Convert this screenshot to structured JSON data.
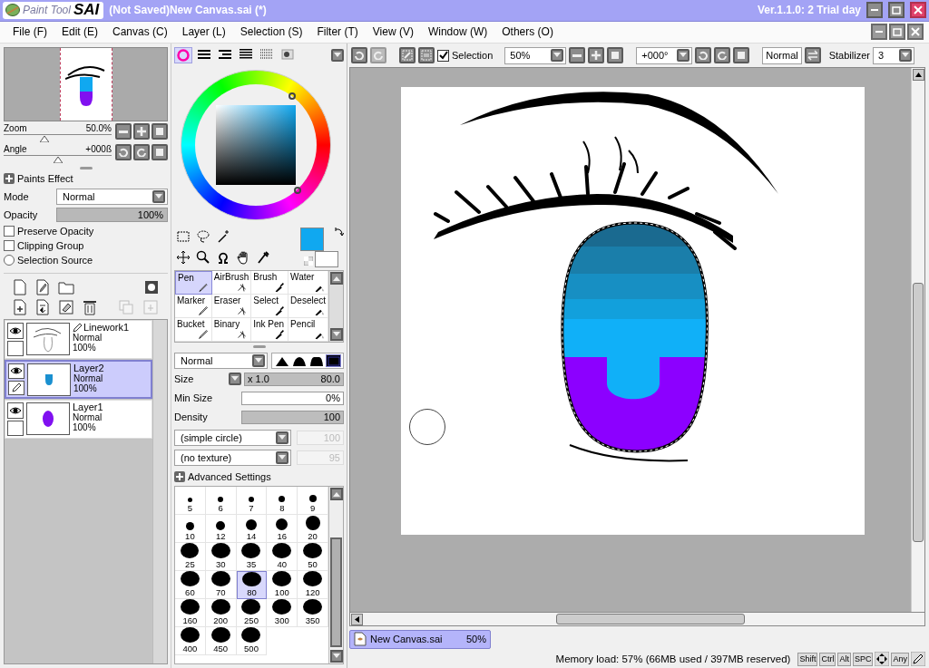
{
  "title_bar": {
    "logo_text": "Paint Tool",
    "logo_mark": "SAI",
    "document_title": "(Not Saved)New Canvas.sai (*)",
    "version": "Ver.1.1.0: 2 Trial day"
  },
  "menu": [
    "File (F)",
    "Edit (E)",
    "Canvas (C)",
    "Layer (L)",
    "Selection (S)",
    "Filter (T)",
    "View (V)",
    "Window (W)",
    "Others (O)"
  ],
  "navigator": {
    "zoom": {
      "label": "Zoom",
      "value": "50.0%",
      "level": 0.38
    },
    "angle": {
      "label": "Angle",
      "value": "+000ß",
      "level": 0.5
    }
  },
  "paints_effect": {
    "title": "Paints Effect",
    "mode": {
      "label": "Mode",
      "value": "Normal"
    },
    "opacity": {
      "label": "Opacity",
      "value": "100%",
      "level": 1
    },
    "options": [
      {
        "kind": "checkbox",
        "label": "Preserve Opacity",
        "checked": false
      },
      {
        "kind": "checkbox",
        "label": "Clipping Group",
        "checked": false
      },
      {
        "kind": "radio",
        "label": "Selection Source",
        "checked": false
      }
    ]
  },
  "layers": [
    {
      "name": "Linework1",
      "kind": "linework",
      "blend": "Normal",
      "opacity": "100%",
      "visible": true,
      "selected": false
    },
    {
      "name": "Layer2",
      "kind": "normal",
      "blend": "Normal",
      "opacity": "100%",
      "visible": true,
      "selected": true
    },
    {
      "name": "Layer1",
      "kind": "normal",
      "blend": "Normal",
      "opacity": "100%",
      "visible": true,
      "selected": false
    }
  ],
  "color_modes": [
    {
      "selected": true
    },
    {
      "selected": false
    },
    {
      "selected": false
    },
    {
      "selected": false
    },
    {
      "selected": false
    },
    {
      "selected": false
    }
  ],
  "tools": [
    {
      "label": "Pen",
      "selected": true
    },
    {
      "label": "AirBrush",
      "selected": false
    },
    {
      "label": "Brush",
      "selected": false
    },
    {
      "label": "Water",
      "selected": false
    },
    {
      "label": "Marker",
      "selected": false
    },
    {
      "label": "Eraser",
      "selected": false
    },
    {
      "label": "Select",
      "selected": false
    },
    {
      "label": "Deselect",
      "selected": false
    },
    {
      "label": "Bucket",
      "selected": false
    },
    {
      "label": "Binary",
      "selected": false
    },
    {
      "label": "Ink Pen",
      "selected": false
    },
    {
      "label": "Pencil",
      "selected": false
    }
  ],
  "brush": {
    "blend": "Normal",
    "shapes": [
      {
        "selected": false
      },
      {
        "selected": false
      },
      {
        "selected": false
      },
      {
        "selected": true
      }
    ],
    "size": {
      "label": "Size",
      "multiplier": "x 1.0",
      "value": "80.0",
      "level": 1
    },
    "min_size": {
      "label": "Min Size",
      "value": "0%",
      "level": 0
    },
    "density": {
      "label": "Density",
      "value": "100",
      "level": 1
    },
    "shape": {
      "value": "(simple circle)",
      "strength": "100"
    },
    "texture": {
      "value": "(no texture)",
      "strength": "95"
    },
    "advanced": "Advanced Settings"
  },
  "brush_sizes": [
    {
      "label": "5",
      "selected": false
    },
    {
      "label": "6",
      "selected": false
    },
    {
      "label": "7",
      "selected": false
    },
    {
      "label": "8",
      "selected": false
    },
    {
      "label": "9",
      "selected": false
    },
    {
      "label": "10",
      "selected": false
    },
    {
      "label": "12",
      "selected": false
    },
    {
      "label": "14",
      "selected": false
    },
    {
      "label": "16",
      "selected": false
    },
    {
      "label": "20",
      "selected": false
    },
    {
      "label": "25",
      "selected": false
    },
    {
      "label": "30",
      "selected": false
    },
    {
      "label": "35",
      "selected": false
    },
    {
      "label": "40",
      "selected": false
    },
    {
      "label": "50",
      "selected": false
    },
    {
      "label": "60",
      "selected": false
    },
    {
      "label": "70",
      "selected": false
    },
    {
      "label": "80",
      "selected": true
    },
    {
      "label": "100",
      "selected": false
    },
    {
      "label": "120",
      "selected": false
    },
    {
      "label": "160",
      "selected": false
    },
    {
      "label": "200",
      "selected": false
    },
    {
      "label": "250",
      "selected": false
    },
    {
      "label": "300",
      "selected": false
    },
    {
      "label": "350",
      "selected": false
    },
    {
      "label": "400",
      "selected": false
    },
    {
      "label": "450",
      "selected": false
    },
    {
      "label": "500",
      "selected": false
    }
  ],
  "canvas_toolbar": {
    "selection": {
      "label": "Selection",
      "checked": true
    },
    "zoom": "50%",
    "angle": "+000°",
    "blend": "Normal",
    "stabilizer": {
      "label": "Stabilizer",
      "value": "3"
    }
  },
  "documents": [
    {
      "name": "New Canvas.sai",
      "zoom": "50%",
      "selected": true
    }
  ],
  "status_bar": {
    "memory": "Memory load: 57% (66MB used / 397MB reserved)",
    "indicators": [
      {
        "kind": "key",
        "label": "Shift"
      },
      {
        "kind": "key",
        "label": "Ctrl"
      },
      {
        "kind": "key",
        "label": "Alt"
      },
      {
        "kind": "key",
        "label": "SPC"
      },
      {
        "kind": "arrows"
      },
      {
        "kind": "key",
        "label": "Any"
      },
      {
        "kind": "pen"
      }
    ]
  }
}
